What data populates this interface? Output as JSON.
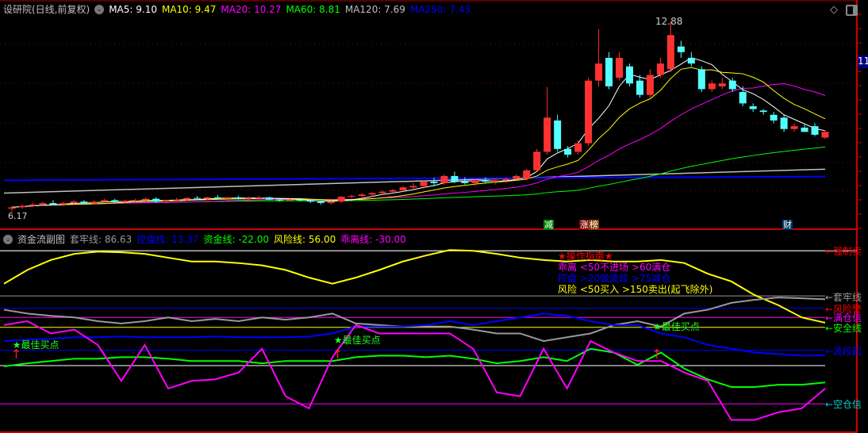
{
  "main": {
    "title": "设研院(日线,前复权)",
    "ma": [
      {
        "label": "MA5: 9.10",
        "color": "#ffffff"
      },
      {
        "label": "MA10: 9.47",
        "color": "#ffff00"
      },
      {
        "label": "MA20: 10.27",
        "color": "#ff00ff"
      },
      {
        "label": "MA60: 8.81",
        "color": "#00ff00"
      },
      {
        "label": "MA120: 7.69",
        "color": "#c0c0c0"
      },
      {
        "label": "MA250: 7.43",
        "color": "#0000ff"
      }
    ],
    "high_label": "12.88",
    "low_label": "6.17",
    "axis_label": "11",
    "tags": [
      {
        "text": "减",
        "color": "#008000"
      },
      {
        "text": "涨",
        "color": "#800000"
      },
      {
        "text": "榜",
        "color": "#804000"
      },
      {
        "text": "财",
        "color": "#003366"
      }
    ]
  },
  "sub": {
    "title": "资金流副图",
    "legend": [
      {
        "label": "套牢线: 86.63",
        "color": "#999999"
      },
      {
        "label": "控盘线: 13.37",
        "color": "#0000ff"
      },
      {
        "label": "资金线: -22.00",
        "color": "#00ff00"
      },
      {
        "label": "风险线: 56.00",
        "color": "#ffff00"
      },
      {
        "label": "乖离线: -30.00",
        "color": "#ff00ff"
      }
    ],
    "guide": [
      {
        "text": "★操作指南★",
        "color": "#ff0000"
      },
      {
        "text": "乖离 <50不进场 >60满仓",
        "color": "#ff00ff"
      },
      {
        "text": "控盘 >20做波段 >75减仓",
        "color": "#0000ff"
      },
      {
        "text": "风险 <50买入 >150卖出(起飞除外)",
        "color": "#ffff00"
      }
    ],
    "buy_label": "最佳买点",
    "right_labels": [
      {
        "text": "←强制卖",
        "color": "#ff0000",
        "value": 150
      },
      {
        "text": "←套牢线",
        "color": "#999999",
        "value": 90
      },
      {
        "text": "←风险警",
        "color": "#ff0000",
        "value": 75
      },
      {
        "text": "←满仓信",
        "color": "#ff00ff",
        "value": 63
      },
      {
        "text": "←安全线",
        "color": "#00ff00",
        "value": 50
      },
      {
        "text": "←波段起",
        "color": "#0000ff",
        "value": 20
      },
      {
        "text": "←空仓信",
        "color": "#00cccc",
        "value": -50
      }
    ]
  },
  "chart_data": {
    "type": "candlestick+line",
    "candles": [
      [
        6.3,
        6.4,
        6.2,
        6.35
      ],
      [
        6.35,
        6.45,
        6.3,
        6.4
      ],
      [
        6.4,
        6.5,
        6.35,
        6.45
      ],
      [
        6.45,
        6.55,
        6.4,
        6.5
      ],
      [
        6.5,
        6.6,
        6.42,
        6.45
      ],
      [
        6.45,
        6.55,
        6.4,
        6.5
      ],
      [
        6.5,
        6.6,
        6.45,
        6.55
      ],
      [
        6.55,
        6.6,
        6.45,
        6.5
      ],
      [
        6.5,
        6.6,
        6.45,
        6.55
      ],
      [
        6.55,
        6.65,
        6.5,
        6.6
      ],
      [
        6.6,
        6.65,
        6.5,
        6.55
      ],
      [
        6.55,
        6.62,
        6.5,
        6.58
      ],
      [
        6.58,
        6.65,
        6.52,
        6.6
      ],
      [
        6.6,
        6.7,
        6.55,
        6.65
      ],
      [
        6.65,
        6.7,
        6.5,
        6.55
      ],
      [
        6.55,
        6.62,
        6.5,
        6.6
      ],
      [
        6.6,
        6.68,
        6.55,
        6.62
      ],
      [
        6.62,
        6.7,
        6.58,
        6.68
      ],
      [
        6.68,
        6.75,
        6.6,
        6.65
      ],
      [
        6.65,
        6.72,
        6.6,
        6.7
      ],
      [
        6.7,
        6.78,
        6.62,
        6.66
      ],
      [
        6.66,
        6.72,
        6.6,
        6.7
      ],
      [
        6.7,
        6.75,
        6.62,
        6.65
      ],
      [
        6.65,
        6.72,
        6.6,
        6.68
      ],
      [
        6.68,
        6.75,
        6.62,
        6.7
      ],
      [
        6.7,
        6.72,
        6.6,
        6.62
      ],
      [
        6.62,
        6.68,
        6.55,
        6.6
      ],
      [
        6.6,
        6.66,
        6.55,
        6.62
      ],
      [
        6.62,
        6.68,
        6.56,
        6.6
      ],
      [
        6.6,
        6.65,
        6.5,
        6.55
      ],
      [
        6.55,
        6.6,
        6.45,
        6.5
      ],
      [
        6.5,
        6.58,
        6.45,
        6.55
      ],
      [
        6.55,
        6.75,
        6.5,
        6.72
      ],
      [
        6.72,
        6.8,
        6.68,
        6.75
      ],
      [
        6.75,
        6.85,
        6.7,
        6.8
      ],
      [
        6.8,
        6.88,
        6.72,
        6.85
      ],
      [
        6.85,
        6.95,
        6.8,
        6.9
      ],
      [
        6.9,
        7.0,
        6.85,
        6.95
      ],
      [
        6.95,
        7.1,
        6.9,
        7.05
      ],
      [
        7.05,
        7.2,
        7.0,
        7.1
      ],
      [
        7.1,
        7.3,
        7.0,
        7.25
      ],
      [
        7.25,
        7.4,
        7.1,
        7.2
      ],
      [
        7.2,
        7.5,
        7.15,
        7.45
      ],
      [
        7.45,
        7.6,
        7.2,
        7.25
      ],
      [
        7.25,
        7.4,
        7.15,
        7.2
      ],
      [
        7.2,
        7.35,
        7.1,
        7.3
      ],
      [
        7.3,
        7.4,
        7.2,
        7.25
      ],
      [
        7.25,
        7.35,
        7.15,
        7.3
      ],
      [
        7.3,
        7.4,
        7.2,
        7.35
      ],
      [
        7.35,
        7.5,
        7.3,
        7.45
      ],
      [
        7.35,
        7.7,
        7.3,
        7.65
      ],
      [
        7.65,
        8.4,
        7.6,
        8.3
      ],
      [
        8.3,
        10.57,
        8.2,
        9.5
      ],
      [
        9.4,
        9.6,
        8.3,
        8.4
      ],
      [
        8.4,
        8.5,
        8.1,
        8.2
      ],
      [
        8.3,
        8.7,
        8.2,
        8.6
      ],
      [
        8.6,
        10.9,
        8.5,
        10.8
      ],
      [
        10.8,
        12.6,
        10.6,
        11.4
      ],
      [
        11.6,
        11.8,
        10.5,
        10.6
      ],
      [
        10.9,
        11.8,
        10.8,
        11.6
      ],
      [
        11.3,
        11.4,
        10.6,
        10.7
      ],
      [
        10.8,
        11.0,
        10.2,
        10.3
      ],
      [
        10.3,
        11.2,
        10.2,
        11.0
      ],
      [
        11.0,
        11.6,
        10.9,
        11.4
      ],
      [
        11.2,
        12.88,
        11.1,
        12.4
      ],
      [
        12.0,
        12.2,
        11.6,
        11.8
      ],
      [
        11.6,
        11.8,
        11.3,
        11.4
      ],
      [
        11.2,
        11.3,
        10.4,
        10.5
      ],
      [
        10.5,
        10.8,
        10.4,
        10.7
      ],
      [
        10.6,
        10.9,
        10.5,
        10.7
      ],
      [
        10.8,
        10.9,
        10.4,
        10.5
      ],
      [
        10.4,
        10.6,
        9.9,
        10.0
      ],
      [
        9.9,
        10.0,
        9.7,
        9.8
      ],
      [
        9.75,
        9.8,
        9.6,
        9.7
      ],
      [
        9.6,
        9.7,
        9.3,
        9.4
      ],
      [
        9.5,
        9.6,
        9.0,
        9.1
      ],
      [
        9.1,
        9.3,
        9.0,
        9.2
      ],
      [
        9.15,
        9.25,
        9.0,
        9.0
      ],
      [
        9.2,
        9.3,
        8.85,
        8.9
      ],
      [
        8.8,
        9.05,
        8.75,
        9.0
      ]
    ],
    "long_ma": {
      "ma120": [
        6.85,
        7.69
      ],
      "ma250": [
        7.3,
        7.43
      ]
    },
    "sub_series": [
      {
        "name": "风险线",
        "color": "#ffff00",
        "values": [
          107,
          125,
          138,
          146,
          149,
          148,
          146,
          141,
          136,
          136,
          134,
          131,
          125,
          115,
          107,
          115,
          125,
          136,
          144,
          151,
          150,
          146,
          141,
          138,
          136,
          138,
          136,
          136,
          138,
          134,
          120,
          110,
          92,
          79,
          63,
          56
        ]
      },
      {
        "name": "套牢线",
        "color": "#999999",
        "values": [
          73,
          68,
          65,
          63,
          58,
          55,
          58,
          63,
          58,
          61,
          58,
          63,
          60,
          63,
          68,
          55,
          53,
          51,
          51,
          51,
          47,
          42,
          42,
          32,
          37,
          42,
          53,
          58,
          51,
          68,
          73,
          82,
          86,
          89,
          88,
          86.63
        ]
      },
      {
        "name": "控盘线",
        "color": "#0000ff",
        "values": [
          32,
          34,
          35,
          37,
          37,
          38,
          37,
          37,
          37,
          38,
          37,
          37,
          37,
          38,
          42,
          51,
          51,
          51,
          53,
          58,
          53,
          58,
          63,
          68,
          65,
          58,
          53,
          53,
          42,
          37,
          27,
          22,
          17,
          15,
          13,
          13.37
        ]
      },
      {
        "name": "资金线",
        "color": "#00ff00",
        "values": [
          -1,
          3,
          6,
          9,
          9,
          11,
          11,
          9,
          6,
          6,
          6,
          3,
          6,
          6,
          6,
          11,
          13,
          13,
          11,
          13,
          9,
          3,
          6,
          11,
          6,
          22,
          17,
          1,
          17,
          -4,
          -18,
          -28,
          -28,
          -25,
          -25,
          -22
        ]
      },
      {
        "name": "乖离线",
        "color": "#ff00ff",
        "values": [
          53,
          58,
          42,
          47,
          27,
          -20,
          27,
          -30,
          -20,
          -18,
          -9,
          22,
          -40,
          -56,
          11,
          53,
          42,
          42,
          42,
          42,
          22,
          -35,
          -40,
          22,
          -30,
          32,
          17,
          6,
          6,
          -9,
          -20,
          -71,
          -71,
          -61,
          -56,
          -30
        ]
      }
    ],
    "ref_lines": [
      {
        "v": 150,
        "c": "#dddddd"
      },
      {
        "v": 91,
        "c": "#999999"
      },
      {
        "v": 75,
        "c": "#0000ff"
      },
      {
        "v": 63,
        "c": "#ff00ff"
      },
      {
        "v": 50,
        "c": "#ffff00"
      },
      {
        "v": 20,
        "c": "#0000ff"
      },
      {
        "v": 0,
        "c": "#ffffff"
      },
      {
        "v": -50,
        "c": "#ff00ff"
      }
    ],
    "buy_points": [
      0.5,
      14.2,
      27.8
    ]
  }
}
